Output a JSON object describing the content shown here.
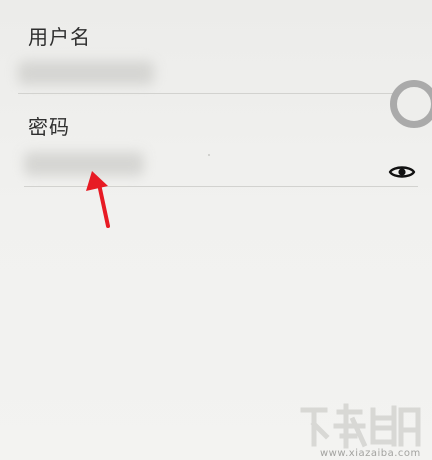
{
  "form": {
    "username_label": "用户名",
    "password_label": "密码"
  },
  "watermark": {
    "text": "www.xiazaiba.com"
  },
  "icons": {
    "eye_icon": "eye-icon",
    "ring_icon": "loading-ring-icon"
  },
  "colors": {
    "arrow": "#e71b24",
    "label": "#2f2f2f",
    "divider": "#d2d2cf"
  }
}
